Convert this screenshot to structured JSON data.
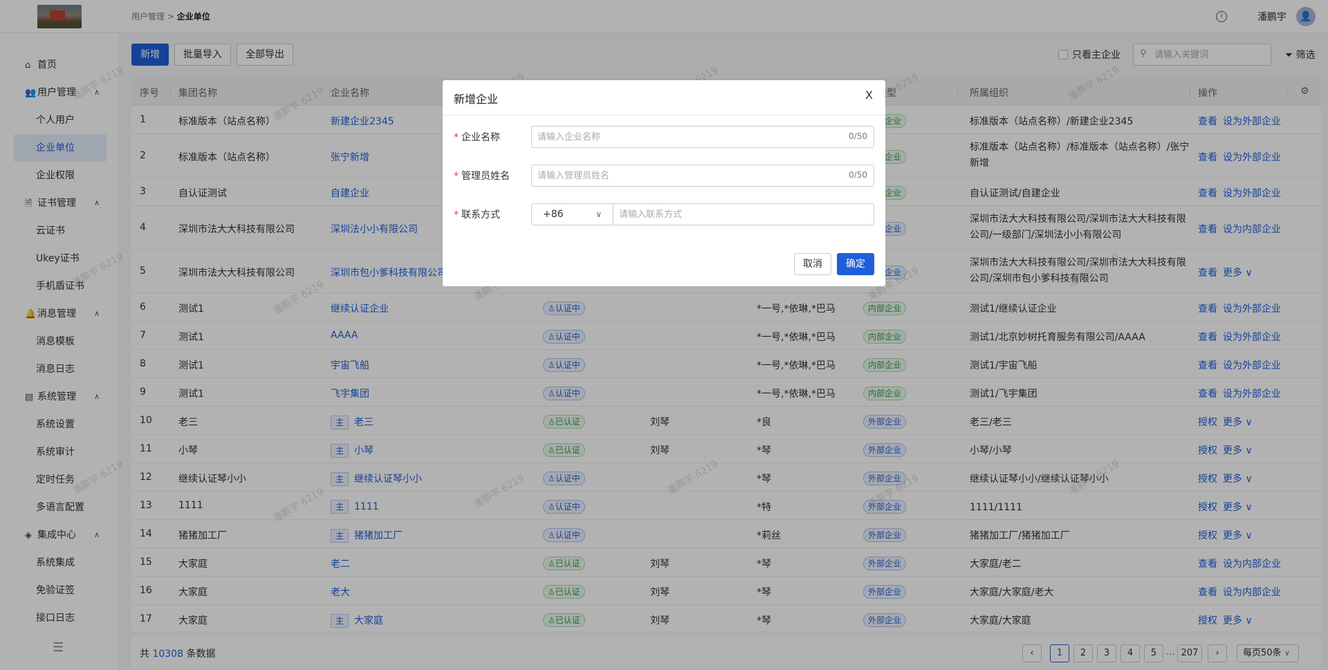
{
  "header": {
    "breadcrumb_parent": "用户管理",
    "breadcrumb_sep": ">",
    "breadcrumb_current": "企业单位",
    "info_icon": "i",
    "username": "潘鹏宇"
  },
  "sidebar": {
    "items": [
      {
        "label": "首页",
        "icon": "⌂",
        "type": "grp"
      },
      {
        "label": "用户管理",
        "icon": "👥",
        "type": "grp",
        "expanded": true
      },
      {
        "label": "个人用户",
        "type": "sub"
      },
      {
        "label": "企业单位",
        "type": "sub",
        "active": true
      },
      {
        "label": "企业权限",
        "type": "sub"
      },
      {
        "label": "证书管理",
        "icon": "🗎",
        "type": "grp",
        "expanded": true
      },
      {
        "label": "云证书",
        "type": "sub"
      },
      {
        "label": "Ukey证书",
        "type": "sub"
      },
      {
        "label": "手机盾证书",
        "type": "sub"
      },
      {
        "label": "消息管理",
        "icon": "🔔",
        "type": "grp",
        "expanded": true
      },
      {
        "label": "消息模板",
        "type": "sub"
      },
      {
        "label": "消息日志",
        "type": "sub"
      },
      {
        "label": "系统管理",
        "icon": "▤",
        "type": "grp",
        "expanded": true
      },
      {
        "label": "系统设置",
        "type": "sub"
      },
      {
        "label": "系统审计",
        "type": "sub"
      },
      {
        "label": "定时任务",
        "type": "sub"
      },
      {
        "label": "多语言配置",
        "type": "sub"
      },
      {
        "label": "集成中心",
        "icon": "◈",
        "type": "grp",
        "expanded": true
      },
      {
        "label": "系统集成",
        "type": "sub"
      },
      {
        "label": "免验证签",
        "type": "sub"
      },
      {
        "label": "接口日志",
        "type": "sub"
      }
    ]
  },
  "toolbar": {
    "add_label": "新增",
    "import_label": "批量导入",
    "export_label": "全部导出",
    "only_main_label": "只看主企业",
    "search_placeholder": "请输入关键词",
    "filter_label": "筛选"
  },
  "table": {
    "headers": [
      "序号",
      "集团名称",
      "企业名称",
      "类型",
      "所属组织",
      "操作"
    ],
    "rows": [
      {
        "no": "1",
        "group": "标准版本（站点名称）",
        "name": "新建企业2345",
        "main": false,
        "auth": "",
        "person": "",
        "admins": "",
        "type": "内部企业",
        "org": "标准版本（站点名称）/新建企业2345",
        "ops": [
          "查看",
          "设为外部企业"
        ]
      },
      {
        "no": "2",
        "group": "标准版本（站点名称）",
        "name": "张宁新增",
        "main": false,
        "auth": "",
        "person": "",
        "admins": "",
        "type": "内部企业",
        "org": "标准版本（站点名称）/标准版本（站点名称）/张宁新增",
        "ops": [
          "查看",
          "设为外部企业"
        ]
      },
      {
        "no": "3",
        "group": "自认证测试",
        "name": "自建企业",
        "main": false,
        "auth": "",
        "person": "",
        "admins": "",
        "type": "内部企业",
        "org": "自认证测试/自建企业",
        "ops": [
          "查看",
          "设为外部企业"
        ]
      },
      {
        "no": "4",
        "group": "深圳市法大大科技有限公司",
        "name": "深圳法小小有限公司",
        "main": false,
        "auth": "",
        "person": "",
        "admins": "",
        "type": "外部企业",
        "org": "深圳市法大大科技有限公司/深圳市法大大科技有限公司/一级部门/深圳法小小有限公司",
        "ops": [
          "查看",
          "设为内部企业"
        ]
      },
      {
        "no": "5",
        "group": "深圳市法大大科技有限公司",
        "name": "深圳市包小爹科技有限公司",
        "main": false,
        "auth": "",
        "person": "",
        "admins": "",
        "type": "外部企业",
        "org": "深圳市法大大科技有限公司/深圳市法大大科技有限公司/深圳市包小爹科技有限公司",
        "ops": [
          "查看",
          "更多 ∨"
        ]
      },
      {
        "no": "6",
        "group": "测试1",
        "name": "继续认证企业",
        "main": false,
        "auth": "认证中",
        "person": "",
        "admins": "*一号,*依琳,*巴马",
        "type": "内部企业",
        "org": "测试1/继续认证企业",
        "ops": [
          "查看",
          "设为外部企业"
        ]
      },
      {
        "no": "7",
        "group": "测试1",
        "name": "AAAA",
        "main": false,
        "auth": "认证中",
        "person": "",
        "admins": "*一号,*依琳,*巴马",
        "type": "内部企业",
        "org": "测试1/北京妙树托育服务有限公司/AAAA",
        "ops": [
          "查看",
          "设为外部企业"
        ]
      },
      {
        "no": "8",
        "group": "测试1",
        "name": "宇宙飞船",
        "main": false,
        "auth": "认证中",
        "person": "",
        "admins": "*一号,*依琳,*巴马",
        "type": "内部企业",
        "org": "测试1/宇宙飞船",
        "ops": [
          "查看",
          "设为外部企业"
        ]
      },
      {
        "no": "9",
        "group": "测试1",
        "name": "飞宇集团",
        "main": false,
        "auth": "认证中",
        "person": "",
        "admins": "*一号,*依琳,*巴马",
        "type": "内部企业",
        "org": "测试1/飞宇集团",
        "ops": [
          "查看",
          "设为外部企业"
        ]
      },
      {
        "no": "10",
        "group": "老三",
        "name": "老三",
        "main": true,
        "auth": "已认证",
        "person": "刘琴",
        "admins": "*良",
        "type": "外部企业",
        "org": "老三/老三",
        "ops": [
          "授权",
          "更多 ∨"
        ]
      },
      {
        "no": "11",
        "group": "小琴",
        "name": "小琴",
        "main": true,
        "auth": "已认证",
        "person": "刘琴",
        "admins": "*琴",
        "type": "外部企业",
        "org": "小琴/小琴",
        "ops": [
          "授权",
          "更多 ∨"
        ]
      },
      {
        "no": "12",
        "group": "继续认证琴小小",
        "name": "继续认证琴小小",
        "main": true,
        "auth": "认证中",
        "person": "",
        "admins": "*琴",
        "type": "外部企业",
        "org": "继续认证琴小小/继续认证琴小小",
        "ops": [
          "授权",
          "更多 ∨"
        ]
      },
      {
        "no": "13",
        "group": "1111",
        "name": "1111",
        "main": true,
        "auth": "认证中",
        "person": "",
        "admins": "*特",
        "type": "外部企业",
        "org": "1111/1111",
        "ops": [
          "授权",
          "更多 ∨"
        ]
      },
      {
        "no": "14",
        "group": "猪猪加工厂",
        "name": "猪猪加工厂",
        "main": true,
        "auth": "认证中",
        "person": "",
        "admins": "*莉丝",
        "type": "外部企业",
        "org": "猪猪加工厂/猪猪加工厂",
        "ops": [
          "授权",
          "更多 ∨"
        ]
      },
      {
        "no": "15",
        "group": "大家庭",
        "name": "老二",
        "main": false,
        "auth": "已认证",
        "person": "刘琴",
        "admins": "*琴",
        "type": "外部企业",
        "org": "大家庭/老二",
        "ops": [
          "查看",
          "设为内部企业"
        ]
      },
      {
        "no": "16",
        "group": "大家庭",
        "name": "老大",
        "main": false,
        "auth": "已认证",
        "person": "刘琴",
        "admins": "*琴",
        "type": "外部企业",
        "org": "大家庭/大家庭/老大",
        "ops": [
          "查看",
          "设为内部企业"
        ]
      },
      {
        "no": "17",
        "group": "大家庭",
        "name": "大家庭",
        "main": true,
        "auth": "已认证",
        "person": "刘琴",
        "admins": "*琴",
        "type": "外部企业",
        "org": "大家庭/大家庭",
        "ops": [
          "授权",
          "更多 ∨"
        ]
      }
    ]
  },
  "footer": {
    "total_prefix": "共",
    "total_count": "10308",
    "total_suffix": "条数据",
    "pages": [
      "1",
      "2",
      "3",
      "4",
      "5"
    ],
    "ellipsis": "...",
    "last_page": "207",
    "page_size": "每页50条"
  },
  "watermark": "潘鹏宇 6219",
  "modal": {
    "title": "新增企业",
    "close": "X",
    "fields": [
      {
        "label": "企业名称",
        "placeholder": "请输入企业名称",
        "count": "0/50"
      },
      {
        "label": "管理员姓名",
        "placeholder": "请输入管理员姓名",
        "count": "0/50"
      },
      {
        "label": "联系方式",
        "country_code": "+86",
        "placeholder": "请输入联系方式"
      }
    ],
    "cancel_label": "取消",
    "ok_label": "确定"
  },
  "colors": {
    "primary": "#1f5fd9",
    "success": "#2e9d48",
    "required": "#e23c3c"
  }
}
